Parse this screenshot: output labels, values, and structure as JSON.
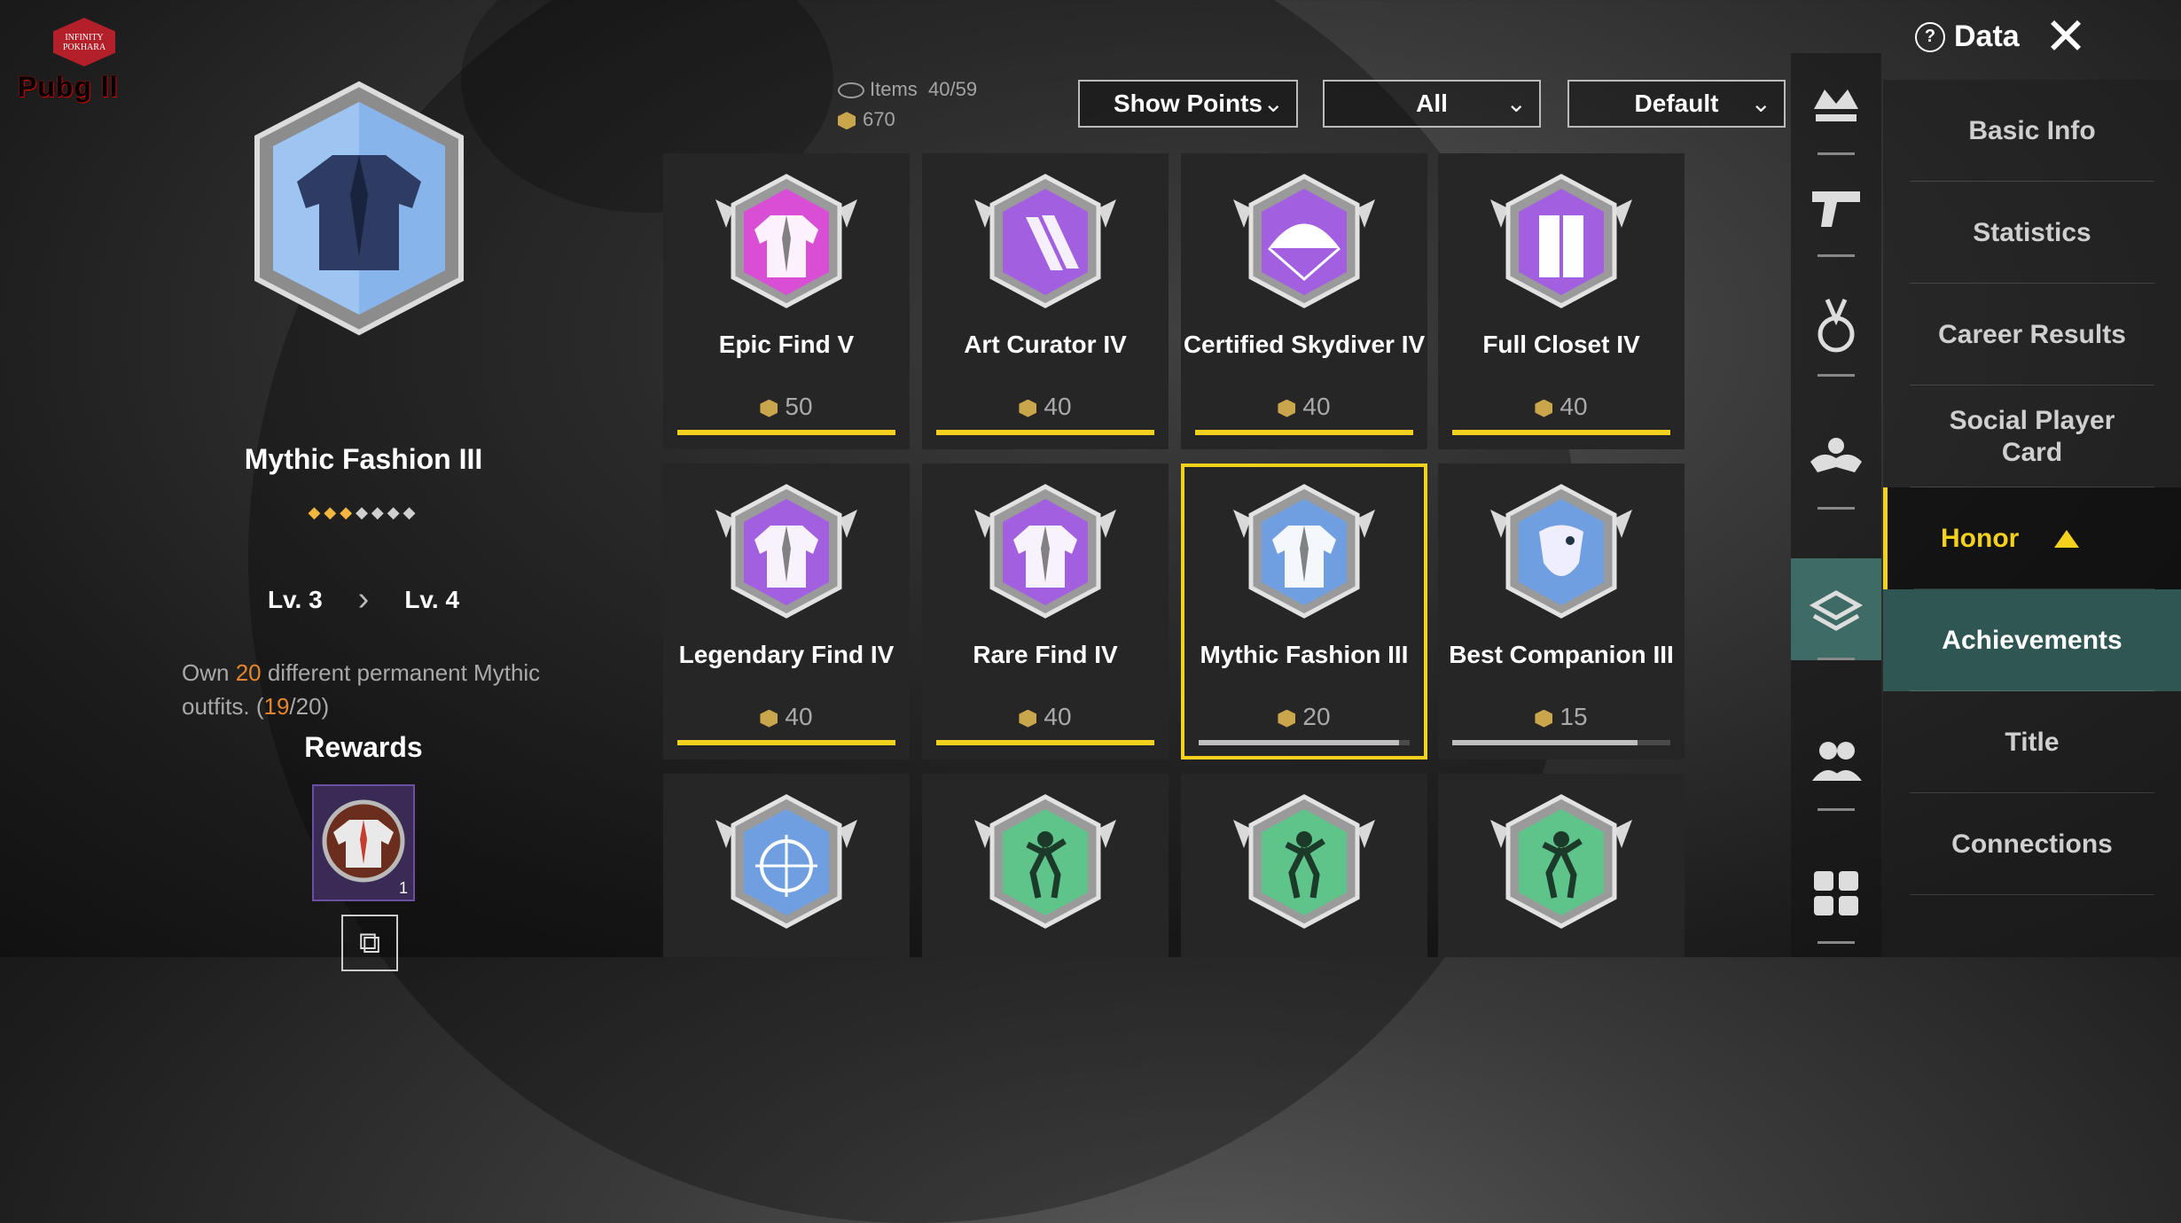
{
  "watermark": {
    "badge_top": "INFINITY",
    "badge_bottom": "POKHARA",
    "brand": "Pubg  ll"
  },
  "detail": {
    "title": "Mythic Fashion III",
    "stars_filled": 3,
    "stars_total": 7,
    "level_from": "Lv. 3",
    "level_to": "Lv. 4",
    "desc_pre": "Own ",
    "desc_num": "20",
    "desc_mid": " different permanent Mythic outfits. (",
    "desc_progress": "19",
    "desc_total": "/20)",
    "rewards_label": "Rewards",
    "reward_count": "1"
  },
  "header": {
    "items_label": "Items",
    "items_value": "40/59",
    "points": "670",
    "filters": [
      {
        "label": "Show Points"
      },
      {
        "label": "All"
      },
      {
        "label": "Default"
      }
    ],
    "data_label": "Data",
    "close_glyph": "✕"
  },
  "achievements": [
    {
      "name": "Epic Find V",
      "points": "50",
      "progress": 1.0,
      "color": "#d84fd6",
      "icon": "jacket-icon"
    },
    {
      "name": "Art Curator IV",
      "points": "40",
      "progress": 1.0,
      "color": "#a25fe0",
      "icon": "claw-icon"
    },
    {
      "name": "Certified Skydiver IV",
      "points": "40",
      "progress": 1.0,
      "color": "#a25fe0",
      "icon": "parachute-icon"
    },
    {
      "name": "Full Closet IV",
      "points": "40",
      "progress": 1.0,
      "color": "#a25fe0",
      "icon": "closet-icon"
    },
    {
      "name": "Legendary Find IV",
      "points": "40",
      "progress": 1.0,
      "color": "#a25fe0",
      "icon": "jacket-icon"
    },
    {
      "name": "Rare Find IV",
      "points": "40",
      "progress": 1.0,
      "color": "#a25fe0",
      "icon": "jacket-icon"
    },
    {
      "name": "Mythic Fashion III",
      "points": "20",
      "progress": 0.95,
      "color": "#6f9fe0",
      "icon": "jacket-icon",
      "selected": true
    },
    {
      "name": "Best Companion III",
      "points": "15",
      "progress": 0.85,
      "color": "#6f9fe0",
      "icon": "eagle-icon"
    },
    {
      "name": "",
      "points": "",
      "progress": 0,
      "color": "#6f9fe0",
      "icon": "crosshair-icon"
    },
    {
      "name": "",
      "points": "",
      "progress": 0,
      "color": "#5fc48a",
      "icon": "dancer-icon"
    },
    {
      "name": "",
      "points": "",
      "progress": 0,
      "color": "#5fc48a",
      "icon": "dancer-icon"
    },
    {
      "name": "",
      "points": "",
      "progress": 0,
      "color": "#5fc48a",
      "icon": "dancer-icon"
    }
  ],
  "rail": [
    {
      "icon": "crown-icon"
    },
    {
      "icon": "pistol-icon"
    },
    {
      "icon": "medal-icon"
    },
    {
      "icon": "muscle-icon"
    },
    {
      "icon": "honor-icon",
      "active": true
    },
    {
      "icon": "friends-icon"
    },
    {
      "icon": "grid-icon"
    }
  ],
  "menu": {
    "basic_info": "Basic Info",
    "statistics": "Statistics",
    "career_results": "Career Results",
    "social_card": "Social Player Card",
    "honor": "Honor",
    "achievements": "Achievements",
    "title": "Title",
    "connections": "Connections"
  }
}
